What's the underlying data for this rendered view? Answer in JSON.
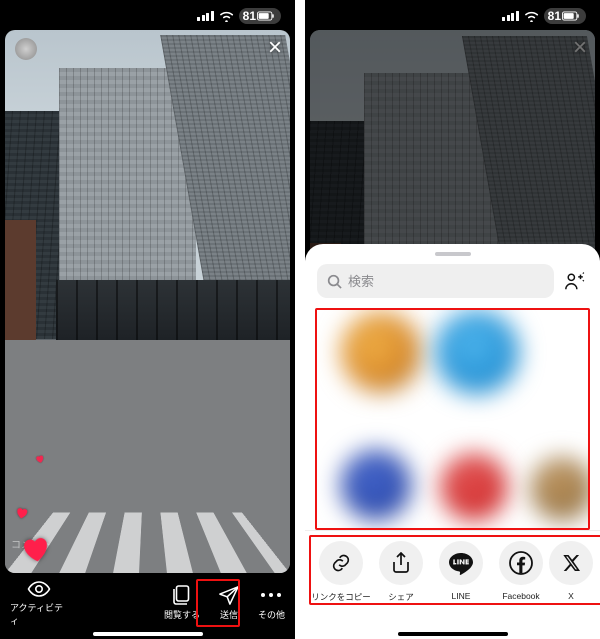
{
  "status": {
    "battery_pct": "81"
  },
  "story": {
    "close_label": "×",
    "comment_placeholder": "コメント"
  },
  "actionbar": {
    "activity": "アクティビティ",
    "browse": "閲覧する",
    "send": "送信",
    "more": "その他"
  },
  "share": {
    "search_placeholder": "検索",
    "options": {
      "copy_link": "リンクをコピー",
      "share": "シェア",
      "line": "LINE",
      "facebook": "Facebook",
      "x": "X"
    }
  }
}
